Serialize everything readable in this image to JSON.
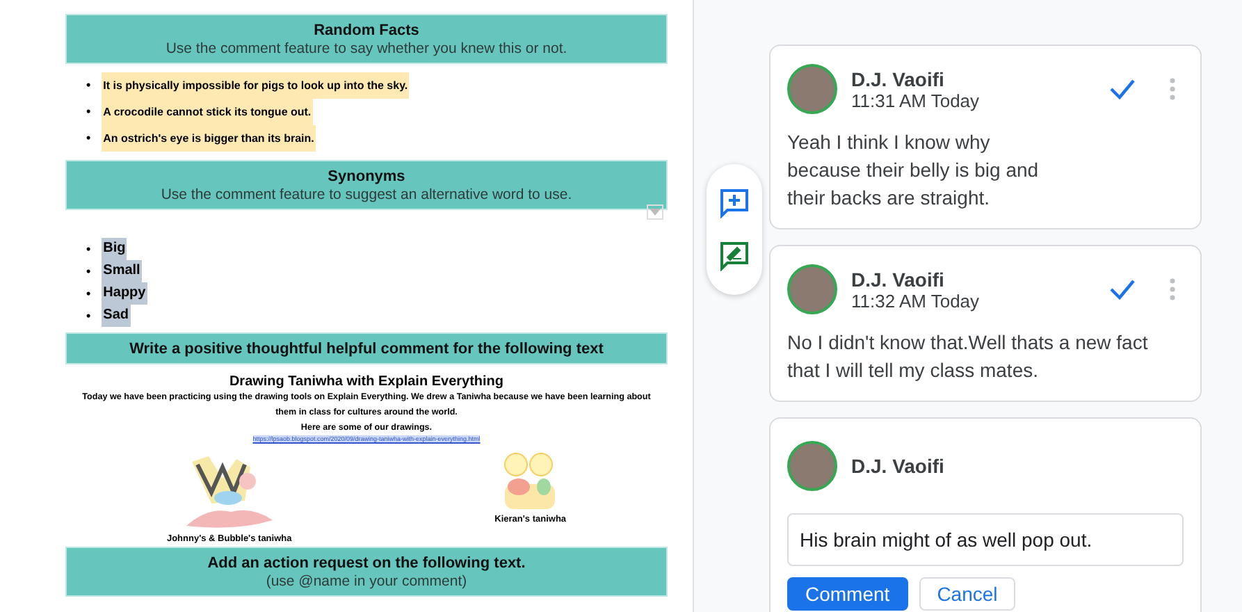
{
  "document": {
    "sections": [
      {
        "kind": "header",
        "title": "Random Facts",
        "subtitle": "Use the comment feature to say whether you knew this or not."
      },
      {
        "kind": "bullets",
        "marker": "•",
        "items": [
          "It is physically impossible for pigs to look up into the sky.",
          "A crocodile cannot stick its tongue out.",
          "An ostrich's eye is bigger than its brain."
        ]
      },
      {
        "kind": "header",
        "title": "Synonyms",
        "subtitle": "Use the comment feature to suggest an alternative word to use."
      },
      {
        "kind": "bigbullets",
        "marker": "•",
        "items": [
          "Big",
          "Small",
          "Happy",
          "Sad"
        ]
      },
      {
        "kind": "header",
        "title": "Write a positive thoughtful helpful comment for the following text"
      },
      {
        "kind": "post",
        "title": "Drawing Taniwha with Explain Everything",
        "body": "Today we have been practicing using the drawing tools on Explain Everything. We drew a Taniwha because we have been learning about them in class for cultures around the world.",
        "note": "Here are some of our drawings.",
        "link": "https://lpsaob.blogspot.com/2020/09/drawing-taniwha-with-explain-everything.html",
        "drawings": [
          {
            "kind": "picture",
            "caption": "Johnny's & Bubble's taniwha"
          },
          {
            "kind": "picture",
            "caption": "Kieran's taniwha"
          }
        ]
      },
      {
        "kind": "header",
        "title": "Add an action request on the following text.",
        "subtitle": "(use @name in your comment)"
      }
    ]
  },
  "comments": [
    {
      "author": "D.J. Vaoifi",
      "time": "11:31 AM Today",
      "body": "Yeah I think I know why\nbecause their belly is big and\ntheir backs are straight."
    },
    {
      "author": "D.J. Vaoifi",
      "time": "11:32 AM Today",
      "body": "No I didn't know that.Well thats a new fact that I will tell my class mates."
    }
  ],
  "reply": {
    "author": "D.J. Vaoifi",
    "value": "His brain might of as well pop out.",
    "buttons": [
      "Comment",
      "Cancel"
    ]
  }
}
